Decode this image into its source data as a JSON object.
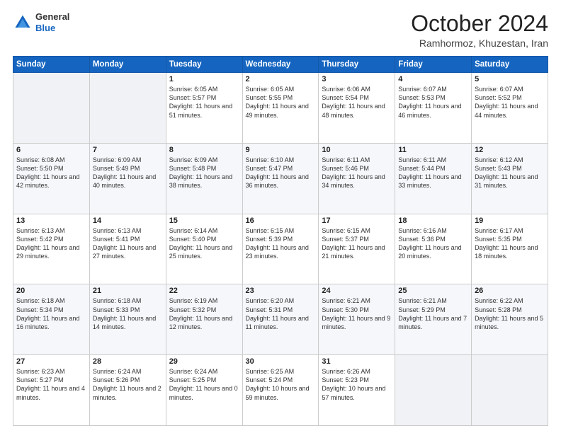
{
  "header": {
    "logo": {
      "general": "General",
      "blue": "Blue"
    },
    "title": "October 2024",
    "subtitle": "Ramhormoz, Khuzestan, Iran"
  },
  "weekdays": [
    "Sunday",
    "Monday",
    "Tuesday",
    "Wednesday",
    "Thursday",
    "Friday",
    "Saturday"
  ],
  "weeks": [
    [
      {
        "day": "",
        "info": ""
      },
      {
        "day": "",
        "info": ""
      },
      {
        "day": "1",
        "info": "Sunrise: 6:05 AM\nSunset: 5:57 PM\nDaylight: 11 hours and 51 minutes."
      },
      {
        "day": "2",
        "info": "Sunrise: 6:05 AM\nSunset: 5:55 PM\nDaylight: 11 hours and 49 minutes."
      },
      {
        "day": "3",
        "info": "Sunrise: 6:06 AM\nSunset: 5:54 PM\nDaylight: 11 hours and 48 minutes."
      },
      {
        "day": "4",
        "info": "Sunrise: 6:07 AM\nSunset: 5:53 PM\nDaylight: 11 hours and 46 minutes."
      },
      {
        "day": "5",
        "info": "Sunrise: 6:07 AM\nSunset: 5:52 PM\nDaylight: 11 hours and 44 minutes."
      }
    ],
    [
      {
        "day": "6",
        "info": "Sunrise: 6:08 AM\nSunset: 5:50 PM\nDaylight: 11 hours and 42 minutes."
      },
      {
        "day": "7",
        "info": "Sunrise: 6:09 AM\nSunset: 5:49 PM\nDaylight: 11 hours and 40 minutes."
      },
      {
        "day": "8",
        "info": "Sunrise: 6:09 AM\nSunset: 5:48 PM\nDaylight: 11 hours and 38 minutes."
      },
      {
        "day": "9",
        "info": "Sunrise: 6:10 AM\nSunset: 5:47 PM\nDaylight: 11 hours and 36 minutes."
      },
      {
        "day": "10",
        "info": "Sunrise: 6:11 AM\nSunset: 5:46 PM\nDaylight: 11 hours and 34 minutes."
      },
      {
        "day": "11",
        "info": "Sunrise: 6:11 AM\nSunset: 5:44 PM\nDaylight: 11 hours and 33 minutes."
      },
      {
        "day": "12",
        "info": "Sunrise: 6:12 AM\nSunset: 5:43 PM\nDaylight: 11 hours and 31 minutes."
      }
    ],
    [
      {
        "day": "13",
        "info": "Sunrise: 6:13 AM\nSunset: 5:42 PM\nDaylight: 11 hours and 29 minutes."
      },
      {
        "day": "14",
        "info": "Sunrise: 6:13 AM\nSunset: 5:41 PM\nDaylight: 11 hours and 27 minutes."
      },
      {
        "day": "15",
        "info": "Sunrise: 6:14 AM\nSunset: 5:40 PM\nDaylight: 11 hours and 25 minutes."
      },
      {
        "day": "16",
        "info": "Sunrise: 6:15 AM\nSunset: 5:39 PM\nDaylight: 11 hours and 23 minutes."
      },
      {
        "day": "17",
        "info": "Sunrise: 6:15 AM\nSunset: 5:37 PM\nDaylight: 11 hours and 21 minutes."
      },
      {
        "day": "18",
        "info": "Sunrise: 6:16 AM\nSunset: 5:36 PM\nDaylight: 11 hours and 20 minutes."
      },
      {
        "day": "19",
        "info": "Sunrise: 6:17 AM\nSunset: 5:35 PM\nDaylight: 11 hours and 18 minutes."
      }
    ],
    [
      {
        "day": "20",
        "info": "Sunrise: 6:18 AM\nSunset: 5:34 PM\nDaylight: 11 hours and 16 minutes."
      },
      {
        "day": "21",
        "info": "Sunrise: 6:18 AM\nSunset: 5:33 PM\nDaylight: 11 hours and 14 minutes."
      },
      {
        "day": "22",
        "info": "Sunrise: 6:19 AM\nSunset: 5:32 PM\nDaylight: 11 hours and 12 minutes."
      },
      {
        "day": "23",
        "info": "Sunrise: 6:20 AM\nSunset: 5:31 PM\nDaylight: 11 hours and 11 minutes."
      },
      {
        "day": "24",
        "info": "Sunrise: 6:21 AM\nSunset: 5:30 PM\nDaylight: 11 hours and 9 minutes."
      },
      {
        "day": "25",
        "info": "Sunrise: 6:21 AM\nSunset: 5:29 PM\nDaylight: 11 hours and 7 minutes."
      },
      {
        "day": "26",
        "info": "Sunrise: 6:22 AM\nSunset: 5:28 PM\nDaylight: 11 hours and 5 minutes."
      }
    ],
    [
      {
        "day": "27",
        "info": "Sunrise: 6:23 AM\nSunset: 5:27 PM\nDaylight: 11 hours and 4 minutes."
      },
      {
        "day": "28",
        "info": "Sunrise: 6:24 AM\nSunset: 5:26 PM\nDaylight: 11 hours and 2 minutes."
      },
      {
        "day": "29",
        "info": "Sunrise: 6:24 AM\nSunset: 5:25 PM\nDaylight: 11 hours and 0 minutes."
      },
      {
        "day": "30",
        "info": "Sunrise: 6:25 AM\nSunset: 5:24 PM\nDaylight: 10 hours and 59 minutes."
      },
      {
        "day": "31",
        "info": "Sunrise: 6:26 AM\nSunset: 5:23 PM\nDaylight: 10 hours and 57 minutes."
      },
      {
        "day": "",
        "info": ""
      },
      {
        "day": "",
        "info": ""
      }
    ]
  ]
}
